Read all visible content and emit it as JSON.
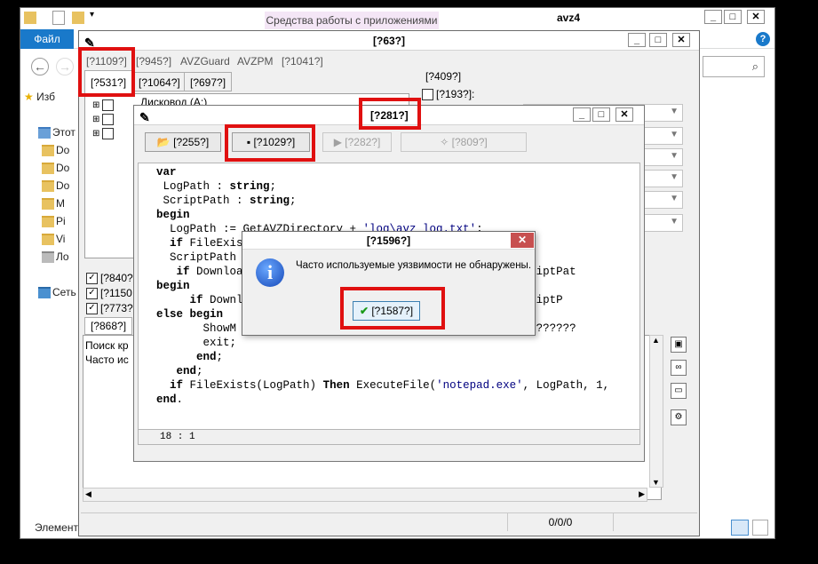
{
  "explorer": {
    "title": "avz4",
    "context_tab": "Средства работы с приложениями",
    "file_tab": "Файл",
    "help_icon": "help-icon",
    "left_items": [
      "Изб",
      "Этот",
      "Do",
      "Do",
      "Do",
      "M",
      "Pi",
      "Vi",
      "Ло",
      "Сеть"
    ],
    "status_left": "Элемент"
  },
  "avz": {
    "title": "[?63?]",
    "menu": [
      "[?1109?]",
      "[?945?]",
      "AVZGuard",
      "AVZPM",
      "[?1041?]"
    ],
    "tabs": [
      "[?531?]",
      "[?1064?]",
      "[?697?]"
    ],
    "disk_label": "Дисковод (A:)",
    "right_label": "[?409?]",
    "right_check_label": "[?193?]:",
    "checks": [
      "[?840?",
      "[?1150",
      "[?773?"
    ],
    "log_tab": "[?868?]",
    "log_lines": [
      "Поиск кр",
      "Часто ис"
    ],
    "status_counter": "0/0/0"
  },
  "script": {
    "title": "[?281?]",
    "buttons": {
      "open": "[?255?]",
      "save": "[?1029?]",
      "run": "[?282?]",
      "check": "[?809?]"
    },
    "cursor": "18 : 1"
  },
  "dialog": {
    "title": "[?1596?]",
    "message": "Часто используемые уязвимости не обнаружены.",
    "ok": "[?1587?]"
  },
  "colors": {
    "highlight": "#e01010",
    "file_tab": "#1979ca",
    "context_tab": "#f4e6f6"
  }
}
